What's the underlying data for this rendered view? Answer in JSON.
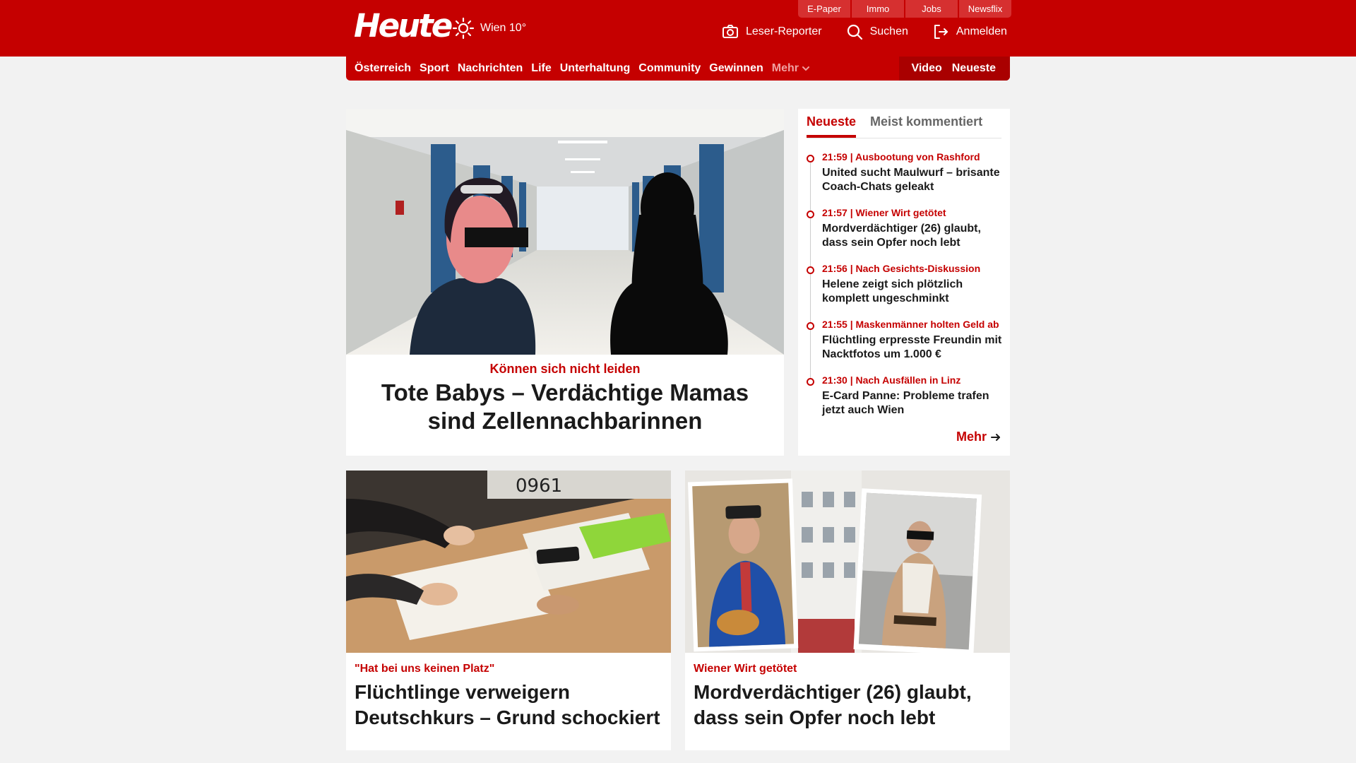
{
  "header": {
    "logo": "Heute",
    "weather": {
      "location": "Wien 10°",
      "icon": "sun-icon"
    },
    "service_tabs": [
      "E-Paper",
      "Immo",
      "Jobs",
      "Newsflix"
    ],
    "actions": [
      {
        "label": "Leser-Reporter",
        "icon": "camera-icon"
      },
      {
        "label": "Suchen",
        "icon": "search-icon"
      },
      {
        "label": "Anmelden",
        "icon": "login-icon"
      }
    ]
  },
  "nav": {
    "items": [
      "Österreich",
      "Sport",
      "Nachrichten",
      "Life",
      "Unterhaltung",
      "Community",
      "Gewinnen"
    ],
    "more": "Mehr",
    "right": [
      "Video",
      "Neueste"
    ]
  },
  "hero": {
    "kicker": "Können sich nicht leiden",
    "title": "Tote Babys – Verdächtige Mamas sind Zellennachbarinnen"
  },
  "sidebar": {
    "tabs": [
      "Neueste",
      "Meist kommentiert"
    ],
    "items": [
      {
        "kicker": "21:59 | Ausbootung von Rashford",
        "title": "United sucht Maulwurf – brisante Coach-Chats geleakt"
      },
      {
        "kicker": "21:57 | Wiener Wirt getötet",
        "title": "Mordverdächtiger (26) glaubt, dass sein Opfer noch lebt"
      },
      {
        "kicker": "21:56 | Nach Gesichts-Diskussion",
        "title": "Helene zeigt sich plötzlich komplett ungeschminkt"
      },
      {
        "kicker": "21:55 | Maskenmänner holten Geld ab",
        "title": "Flüchtling erpresste Freundin mit Nacktfotos um 1.000 €"
      },
      {
        "kicker": "21:30 | Nach Ausfällen in Linz",
        "title": "E-Card Panne: Probleme trafen jetzt auch Wien"
      }
    ],
    "more": "Mehr"
  },
  "cards": [
    {
      "kicker": "\"Hat bei uns keinen Platz\"",
      "title": "Flüchtlinge verweigern Deutschkurs – Grund schockiert"
    },
    {
      "kicker": "Wiener Wirt getötet",
      "title": "Mordverdächtiger (26) glaubt, dass sein Opfer noch lebt"
    }
  ],
  "colors": {
    "brand": "#c50000",
    "brand_dark": "#a90000",
    "page_bg": "#f2f2f2"
  }
}
